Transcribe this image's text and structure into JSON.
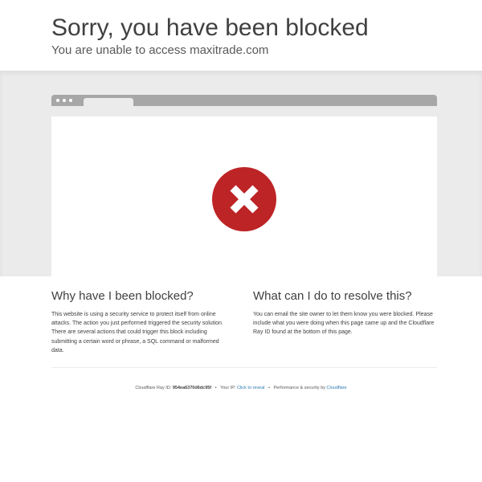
{
  "header": {
    "title": "Sorry, you have been blocked",
    "subtitle": "You are unable to access maxitrade.com"
  },
  "illustration": {
    "icon": "blocked-x-icon",
    "icon_color": "#bd2426"
  },
  "why": {
    "heading": "Why have I been blocked?",
    "body": "This website is using a security service to protect itself from online attacks. The action you just performed triggered the security solution. There are several actions that could trigger this block including submitting a certain word or phrase, a SQL command or malformed data."
  },
  "resolve": {
    "heading": "What can I do to resolve this?",
    "body": "You can email the site owner to let them know you were blocked. Please include what you were doing when this page came up and the Cloudflare Ray ID found at the bottom of this page."
  },
  "footer": {
    "ray_label": "Cloudflare Ray ID:",
    "ray_id": "954ea6370d6dc95f",
    "separator": "•",
    "ip_label": "Your IP:",
    "ip_link": "Click to reveal",
    "perf_label": "Performance & security by",
    "provider_link": "Cloudflare",
    "link_color": "#2c7cb0"
  }
}
